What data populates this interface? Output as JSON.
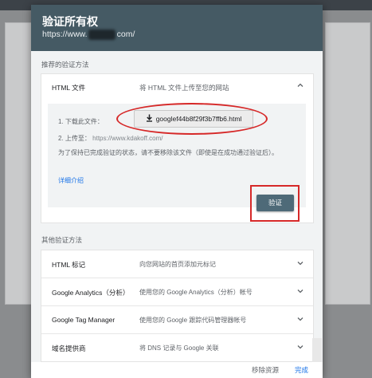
{
  "dialog": {
    "title": "验证所有权",
    "subtitle_start": "https://www.",
    "subtitle_end": "com/"
  },
  "recommended": {
    "section_label": "推荐的验证方法",
    "method_name": "HTML 文件",
    "method_desc": "将 HTML 文件上传至您的网站",
    "step1_label": "1. 下载此文件：",
    "download_file": "googlef44b8f29f3b7ffb6.html",
    "step2_label": "2. 上传至：",
    "upload_url": "https://www.kdakoff.com/",
    "note": "为了保持已完成验证的状态，请不要移除该文件（即使是在成功通过验证后）。",
    "more_link": "详细介绍",
    "verify_label": "验证"
  },
  "other": {
    "section_label": "其他验证方法",
    "methods": [
      {
        "name": "HTML 标记",
        "desc": "向您网站的首页添加元标记"
      },
      {
        "name": "Google Analytics（分析）",
        "desc": "使用您的 Google Analytics（分析）帐号"
      },
      {
        "name": "Google Tag Manager",
        "desc": "使用您的 Google 跟踪代码管理器帐号"
      },
      {
        "name": "域名提供商",
        "desc": "将 DNS 记录与 Google 关联"
      }
    ]
  },
  "footer": {
    "remove_label": "移除资源",
    "done_label": "完成"
  },
  "colors": {
    "header": "#455a64",
    "accent": "#1a73e8",
    "verify_button": "#4e6a78",
    "annotation": "#d62828"
  },
  "icons": {
    "download": "download-icon",
    "collapse": "chevron-up-icon",
    "expand": "chevron-down-icon"
  }
}
